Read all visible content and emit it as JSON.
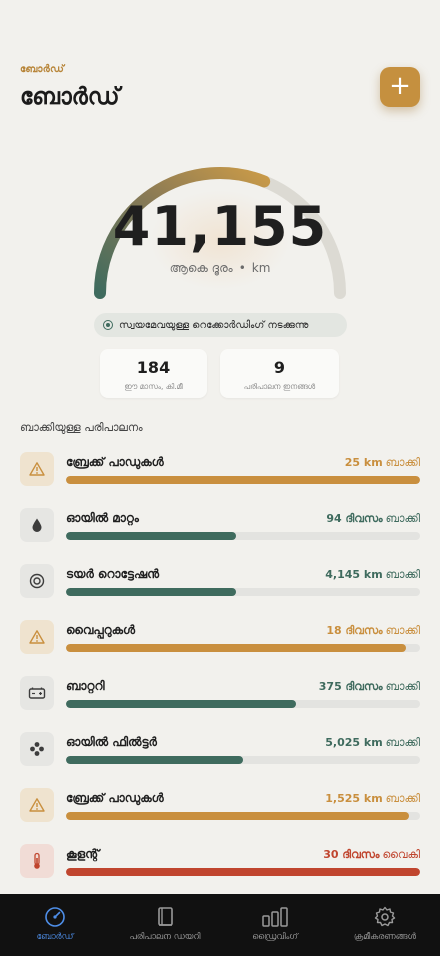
{
  "header": {
    "eyebrow": "ബോർഡ്",
    "title": "ബോർഡ്",
    "add_label": "+"
  },
  "odometer": {
    "value": "41,155",
    "label": "ആകെ ദൂരം",
    "sep": "•",
    "unit": "km",
    "progress": 0.62
  },
  "recording": {
    "text": "സ്വയമേവയുള്ള റെക്കോർഡിംഗ് നടക്കുന്നു"
  },
  "stats": [
    {
      "value": "184",
      "label": "ഈ മാസം, കി.മീ"
    },
    {
      "value": "9",
      "label": "പരിപാലന ഇനങ്ങൾ"
    }
  ],
  "section_title": "ബാക്കിയുള്ള പരിപാലനം",
  "items": [
    {
      "name": "ബ്രേക്ക് പാഡുകൾ",
      "amount": "25 km",
      "suffix": "ബാക്കി",
      "icon": "warning-icon",
      "status": "warn",
      "progress": 1.0
    },
    {
      "name": "ഓയിൽ മാറ്റം",
      "amount": "94 ദിവസം",
      "suffix": "ബാക്കി",
      "icon": "oil-drop-icon",
      "status": "ok",
      "progress": 0.48
    },
    {
      "name": "ടയർ റൊട്ടേഷൻ",
      "amount": "4,145 km",
      "suffix": "ബാക്കി",
      "icon": "tire-icon",
      "status": "ok",
      "progress": 0.48
    },
    {
      "name": "വൈപ്പറുകൾ",
      "amount": "18 ദിവസം",
      "suffix": "ബാക്കി",
      "icon": "warning-icon",
      "status": "warn",
      "progress": 0.96
    },
    {
      "name": "ബാറ്ററി",
      "amount": "375 ദിവസം",
      "suffix": "ബാക്കി",
      "icon": "battery-icon",
      "status": "ok",
      "progress": 0.65
    },
    {
      "name": "ഓയിൽ ഫിൽട്ടർ",
      "amount": "5,025 km",
      "suffix": "ബാക്കി",
      "icon": "filter-icon",
      "status": "ok",
      "progress": 0.5
    },
    {
      "name": "ബ്രേക്ക് പാഡുകൾ",
      "amount": "1,525 km",
      "suffix": "ബാക്കി",
      "icon": "warning-icon",
      "status": "warn",
      "progress": 0.97
    },
    {
      "name": "കൂളന്റ്",
      "amount": "30 ദിവസം",
      "suffix": "വൈകി",
      "icon": "thermometer-icon",
      "status": "overdue",
      "progress": 1.0
    }
  ],
  "tabs": [
    {
      "label": "ബോർഡ്",
      "icon": "dashboard-gauge-icon",
      "active": true
    },
    {
      "label": "പരിപാലന ഡയറി",
      "icon": "book-icon",
      "active": false
    },
    {
      "label": "ഡ്രൈവിംഗ്",
      "icon": "bar-chart-icon",
      "active": false
    },
    {
      "label": "ക്രമീകരണങ്ങൾ",
      "icon": "gear-icon",
      "active": false
    }
  ],
  "colors": {
    "accent": "#c5903f",
    "warn": "#c98f3e",
    "ok": "#3f6b5e",
    "overdue": "#c0452e",
    "track": "#e3e3e0",
    "tab_active": "#4e8ee8"
  }
}
